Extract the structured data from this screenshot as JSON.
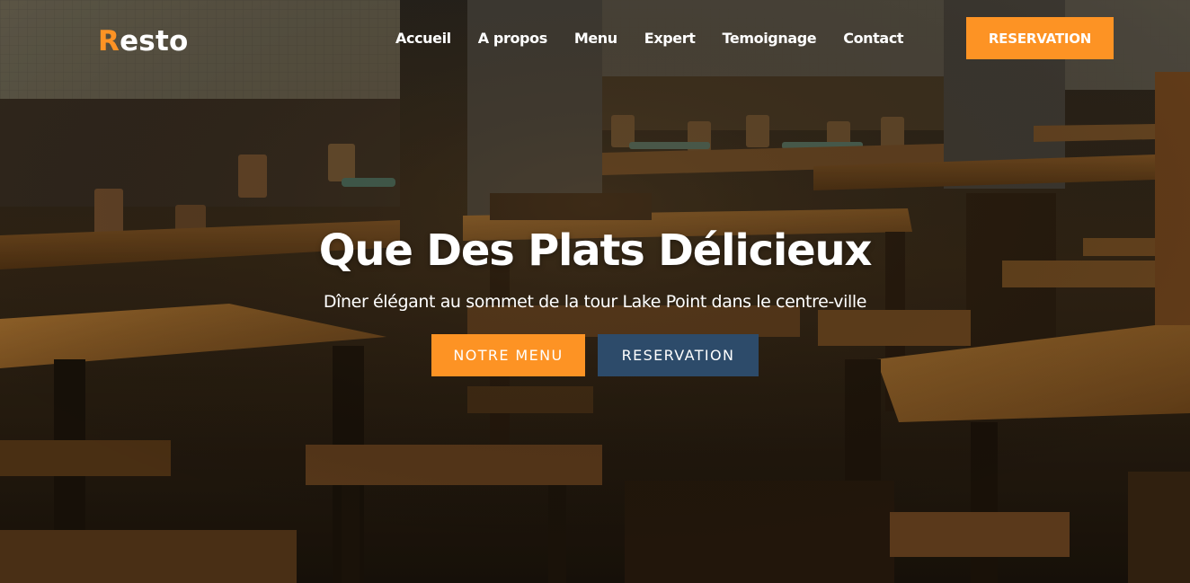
{
  "brand": {
    "first_letter": "R",
    "rest": "esto"
  },
  "nav": {
    "links": [
      "Accueil",
      "A propos",
      "Menu",
      "Expert",
      "Temoignage",
      "Contact"
    ],
    "cta_label": "RESERVATION"
  },
  "hero": {
    "title": "Que Des Plats Délicieux",
    "subtitle": "Dîner élégant au sommet de la tour Lake Point dans le centre-ville",
    "primary_button": "NOTRE MENU",
    "secondary_button": "RESERVATION",
    "background_image": "restaurant-interior-photo"
  },
  "colors": {
    "accent": "#fd9324",
    "secondary": "#2d4b6a",
    "text": "#ffffff"
  }
}
